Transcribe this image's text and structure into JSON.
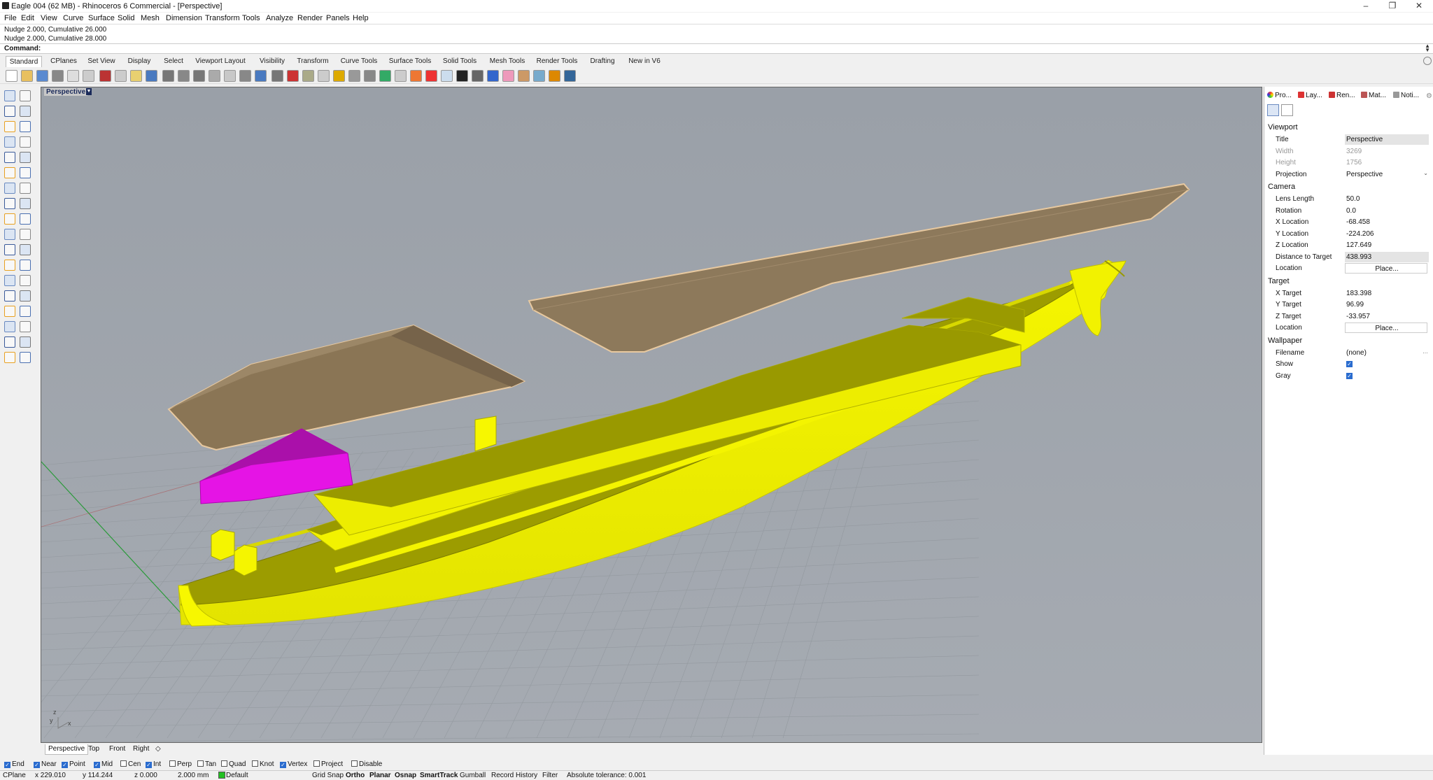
{
  "window": {
    "title": "Eagle 004 (62 MB) - Rhinoceros 6 Commercial - [Perspective]"
  },
  "menu": [
    "File",
    "Edit",
    "View",
    "Curve",
    "Surface",
    "Solid",
    "Mesh",
    "Dimension",
    "Transform",
    "Tools",
    "Analyze",
    "Render",
    "Panels",
    "Help"
  ],
  "history": [
    "Nudge 2.000, Cumulative 26.000",
    "Nudge 2.000, Cumulative 28.000"
  ],
  "command": {
    "label": "Command:",
    "value": ""
  },
  "toolbar_tabs": [
    "Standard",
    "CPlanes",
    "Set View",
    "Display",
    "Select",
    "Viewport Layout",
    "Visibility",
    "Transform",
    "Curve Tools",
    "Surface Tools",
    "Solid Tools",
    "Mesh Tools",
    "Render Tools",
    "Drafting",
    "New in V6"
  ],
  "active_tab": "Standard",
  "viewport": {
    "title": "Perspective",
    "axis_labels": {
      "z": "z",
      "y": "y",
      "x": "x"
    }
  },
  "viewport_tabs": [
    "Perspective",
    "Top",
    "Front",
    "Right"
  ],
  "osnaps": [
    {
      "label": "End",
      "checked": true
    },
    {
      "label": "Near",
      "checked": true
    },
    {
      "label": "Point",
      "checked": true
    },
    {
      "label": "Mid",
      "checked": true
    },
    {
      "label": "Cen",
      "checked": false
    },
    {
      "label": "Int",
      "checked": true
    },
    {
      "label": "Perp",
      "checked": false
    },
    {
      "label": "Tan",
      "checked": false
    },
    {
      "label": "Quad",
      "checked": false
    },
    {
      "label": "Knot",
      "checked": false
    },
    {
      "label": "Vertex",
      "checked": true
    },
    {
      "label": "Project",
      "checked": false
    },
    {
      "label": "Disable",
      "checked": false
    }
  ],
  "status": {
    "cplane": "CPlane",
    "x": "x 229.010",
    "y": "y 114.244",
    "z": "z 0.000",
    "units": "2.000 mm",
    "layer": "Default",
    "modes": [
      {
        "label": "Grid Snap",
        "on": false
      },
      {
        "label": "Ortho",
        "on": true
      },
      {
        "label": "Planar",
        "on": true
      },
      {
        "label": "Osnap",
        "on": true
      },
      {
        "label": "SmartTrack",
        "on": true
      },
      {
        "label": "Gumball",
        "on": false
      },
      {
        "label": "Record History",
        "on": false
      },
      {
        "label": "Filter",
        "on": false
      }
    ],
    "tolerance": "Absolute tolerance: 0.001"
  },
  "panel": {
    "tabs": [
      "Pro...",
      "Lay...",
      "Ren...",
      "Mat...",
      "Noti..."
    ],
    "sections": {
      "viewport": "Viewport",
      "camera": "Camera",
      "target": "Target",
      "wallpaper": "Wallpaper"
    },
    "viewport_rows": [
      {
        "label": "Title",
        "value": "Perspective"
      },
      {
        "label": "Width",
        "value": "3269"
      },
      {
        "label": "Height",
        "value": "1756"
      },
      {
        "label": "Projection",
        "value": "Perspective"
      }
    ],
    "camera_rows": [
      {
        "label": "Lens Length",
        "value": "50.0"
      },
      {
        "label": "Rotation",
        "value": "0.0"
      },
      {
        "label": "X Location",
        "value": "-68.458"
      },
      {
        "label": "Y Location",
        "value": "-224.206"
      },
      {
        "label": "Z Location",
        "value": "127.649"
      },
      {
        "label": "Distance to Target",
        "value": "438.993"
      },
      {
        "label": "Location",
        "value": "Place..."
      }
    ],
    "target_rows": [
      {
        "label": "X Target",
        "value": "183.398"
      },
      {
        "label": "Y Target",
        "value": "96.99"
      },
      {
        "label": "Z Target",
        "value": "-33.957"
      },
      {
        "label": "Location",
        "value": "Place..."
      }
    ],
    "wallpaper_rows": [
      {
        "label": "Filename",
        "value": "(none)"
      },
      {
        "label": "Show",
        "value": ""
      },
      {
        "label": "Gray",
        "value": ""
      }
    ]
  },
  "colors": {
    "hull": "#f2f200",
    "hull_shade": "#9a9a00",
    "deck_cover": "#8c785a",
    "cover_edge": "#e8c9a0",
    "magenta": "#e010e0",
    "viewport_bg": "#a0a5ac"
  }
}
